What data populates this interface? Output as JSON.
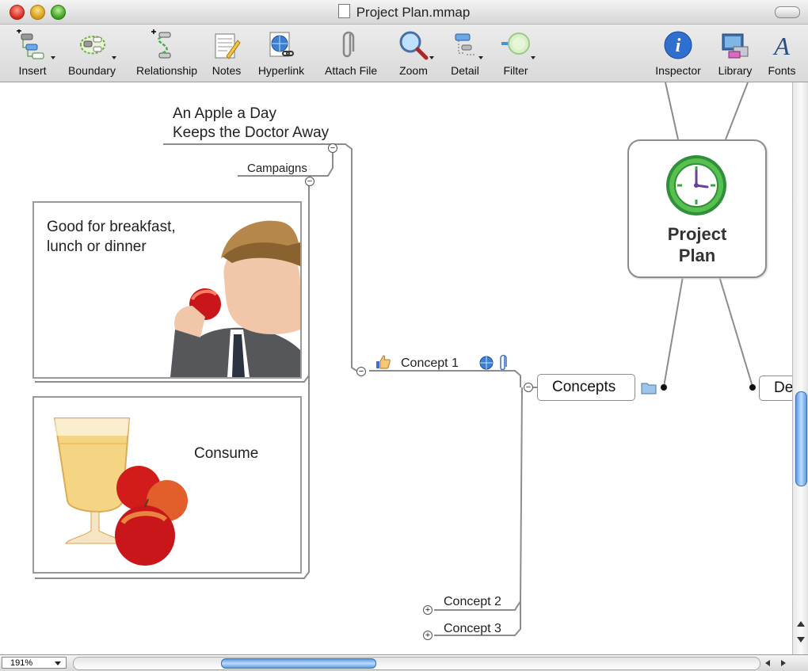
{
  "window": {
    "title": "Project Plan.mmap"
  },
  "toolbar": {
    "items": [
      {
        "label": "Insert",
        "icon": "insert-topic-icon",
        "has_menu": true
      },
      {
        "label": "Boundary",
        "icon": "boundary-icon",
        "has_menu": true
      },
      {
        "label": "Relationship",
        "icon": "relationship-icon",
        "has_menu": false
      },
      {
        "label": "Notes",
        "icon": "notes-icon",
        "has_menu": false
      },
      {
        "label": "Hyperlink",
        "icon": "hyperlink-icon",
        "has_menu": false
      },
      {
        "label": "Attach File",
        "icon": "paperclip-icon",
        "has_menu": false
      },
      {
        "label": "Zoom",
        "icon": "magnifier-icon",
        "has_menu": true
      },
      {
        "label": "Detail",
        "icon": "detail-icon",
        "has_menu": true
      },
      {
        "label": "Filter",
        "icon": "filter-icon",
        "has_menu": true
      },
      {
        "label": "Inspector",
        "icon": "info-icon",
        "has_menu": false
      },
      {
        "label": "Library",
        "icon": "library-icon",
        "has_menu": false
      },
      {
        "label": "Fonts",
        "icon": "fonts-icon",
        "has_menu": false
      }
    ]
  },
  "map": {
    "central_topic": {
      "label_line1": "Project",
      "label_line2": "Plan"
    },
    "main_topics": {
      "concepts": "Concepts",
      "partial": "De"
    },
    "subtopics": {
      "concept1": "Concept 1",
      "concept2": "Concept 2",
      "concept3": "Concept 3",
      "campaigns": "Campaigns",
      "slogan_line1": "An Apple a Day",
      "slogan_line2": "Keeps the Doctor Away",
      "breakfast_line1": "Good for breakfast,",
      "breakfast_line2": "lunch or dinner",
      "consume": "Consume"
    },
    "colors": {
      "clock_green": "#3fae49",
      "clock_face": "#ffffff",
      "clock_hands": "#6b3fa0",
      "line": "#8c8c8c"
    }
  },
  "status": {
    "zoom": "191%"
  }
}
